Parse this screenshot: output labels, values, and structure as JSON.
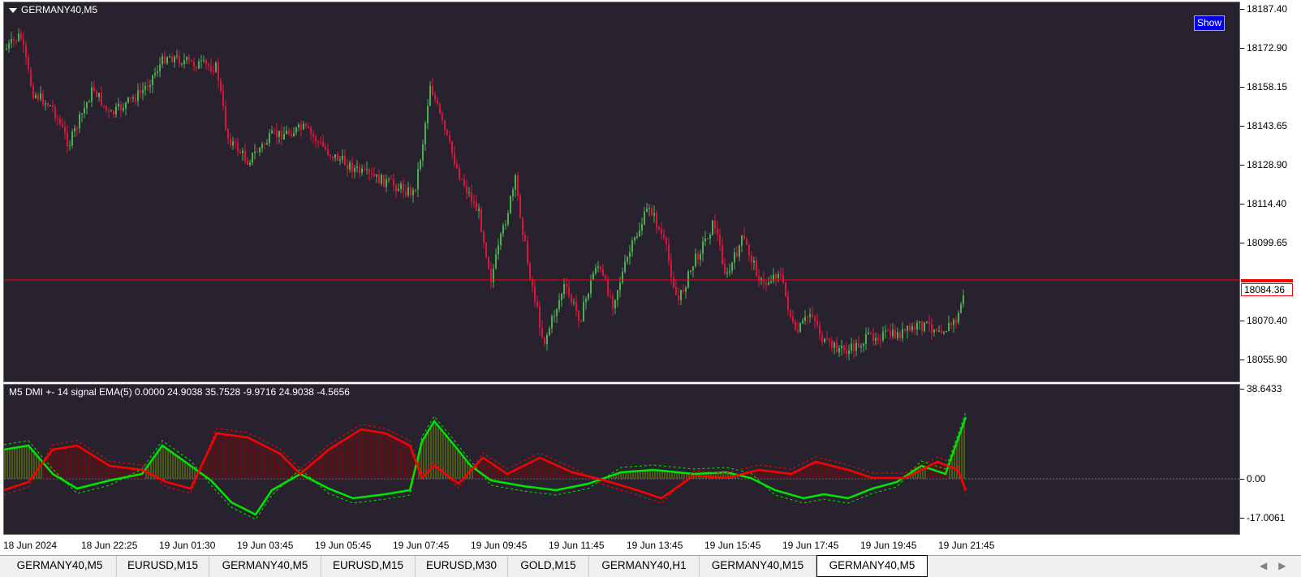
{
  "main_chart": {
    "title": "GERMANY40,M5",
    "show_button": "Show",
    "price_ticks": [
      "18187.40",
      "18172.90",
      "18158.15",
      "18143.65",
      "18128.90",
      "18114.40",
      "18099.65",
      "18070.40",
      "18055.90"
    ],
    "current_price": "18084.36",
    "colors": {
      "background": "#28222f",
      "bull": "#4caf50",
      "bear": "#dc143c",
      "price_line": "#ff0000"
    }
  },
  "indicator": {
    "title": "M5 DMI +- 14  signal EMA(5)  0.0000 24.9038 35.7528 -9.9716 24.9038 -4.5656",
    "axis_ticks": [
      "38.6433",
      "0.00",
      "-17.0061"
    ],
    "colors": {
      "plus_di": "#00e600",
      "minus_di": "#ff0000",
      "hist_pos": "#6b8e00",
      "hist_neg": "#8b0000"
    }
  },
  "time_axis": [
    "18 Jun 2024",
    "18 Jun 22:25",
    "19 Jun 01:30",
    "19 Jun 03:45",
    "19 Jun 05:45",
    "19 Jun 07:45",
    "19 Jun 09:45",
    "19 Jun 11:45",
    "19 Jun 13:45",
    "19 Jun 15:45",
    "19 Jun 17:45",
    "19 Jun 19:45",
    "19 Jun 21:45"
  ],
  "tabs": [
    {
      "label": "GERMANY40,M5",
      "active": false
    },
    {
      "label": "EURUSD,M15",
      "active": false
    },
    {
      "label": "GERMANY40,M5",
      "active": false
    },
    {
      "label": "EURUSD,M15",
      "active": false
    },
    {
      "label": "EURUSD,M30",
      "active": false
    },
    {
      "label": "GOLD,M15",
      "active": false
    },
    {
      "label": "GERMANY40,H1",
      "active": false
    },
    {
      "label": "GERMANY40,M15",
      "active": false
    },
    {
      "label": "GERMANY40,M5",
      "active": true
    }
  ],
  "tab_scroll": {
    "left_icon": "arrow-left-icon",
    "right_icon": "arrow-right-icon"
  }
}
